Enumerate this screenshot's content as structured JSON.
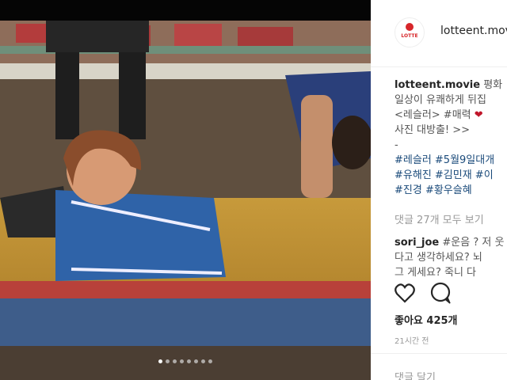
{
  "post": {
    "username": "lotteent.movie",
    "logo_text": "LOTTE",
    "caption_lines": [
      {
        "user": "lotteent.movie",
        "text": " 평화"
      },
      {
        "text": "일상이 유쾌하게 뒤집"
      },
      {
        "text": "<레슬러> #매력",
        "emoji": "❤"
      },
      {
        "text": "사진 대방출! >>"
      },
      {
        "text": "-"
      },
      {
        "text": "#레슬러 #5월9일대개"
      },
      {
        "text": "#유해진 #김민재 #이"
      },
      {
        "text": "#진경 #황우슬혜"
      }
    ],
    "view_all_comments": "댓글 27개 모두 보기",
    "comment": {
      "user": "sori_joe",
      "lines": [
        " #운음 ? 저 웃",
        "다고 생각하세요? 뇌",
        "그 게세요? 죽니 다"
      ]
    },
    "likes": "좋아요 425개",
    "time_ago": "21시간 전",
    "add_comment": "댓글 달기"
  },
  "carousel": {
    "count": 8,
    "active_index": 0
  },
  "icons": [
    "heart-outline-icon",
    "comment-bubble-icon"
  ],
  "colors": {
    "hashtag": "#1a4a7a",
    "logo_red": "#d7262a",
    "muted": "#999999"
  }
}
